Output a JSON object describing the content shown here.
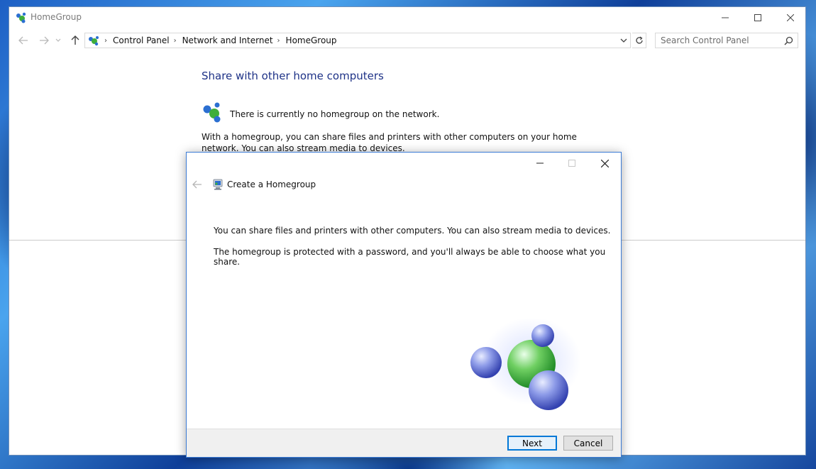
{
  "window": {
    "title": "HomeGroup",
    "controls": {
      "minimize": "minimize",
      "maximize": "maximize",
      "close": "close"
    }
  },
  "navbar": {
    "breadcrumbs": [
      "Control Panel",
      "Network and Internet",
      "HomeGroup"
    ],
    "search_placeholder": "Search Control Panel"
  },
  "content": {
    "heading": "Share with other home computers",
    "status_text": "There is currently no homegroup on the network.",
    "description": "With a homegroup, you can share files and printers with other computers on your home network. You can also stream media to devices."
  },
  "dialog": {
    "title": "Create a Homegroup",
    "line1": "You can share files and printers with other computers. You can also stream media to devices.",
    "line2": "The homegroup is protected with a password, and you'll always be able to choose what you share.",
    "next_label": "Next",
    "cancel_label": "Cancel"
  },
  "colors": {
    "heading": "#1e3287",
    "accent": "#0078d7",
    "homegroup_green": "#3fae3a",
    "homegroup_blue": "#2b6fd1"
  },
  "icons": [
    "homegroup-icon",
    "back-arrow-icon",
    "forward-arrow-icon",
    "up-arrow-icon",
    "refresh-icon",
    "search-icon",
    "close-icon",
    "minimize-icon",
    "maximize-icon"
  ]
}
